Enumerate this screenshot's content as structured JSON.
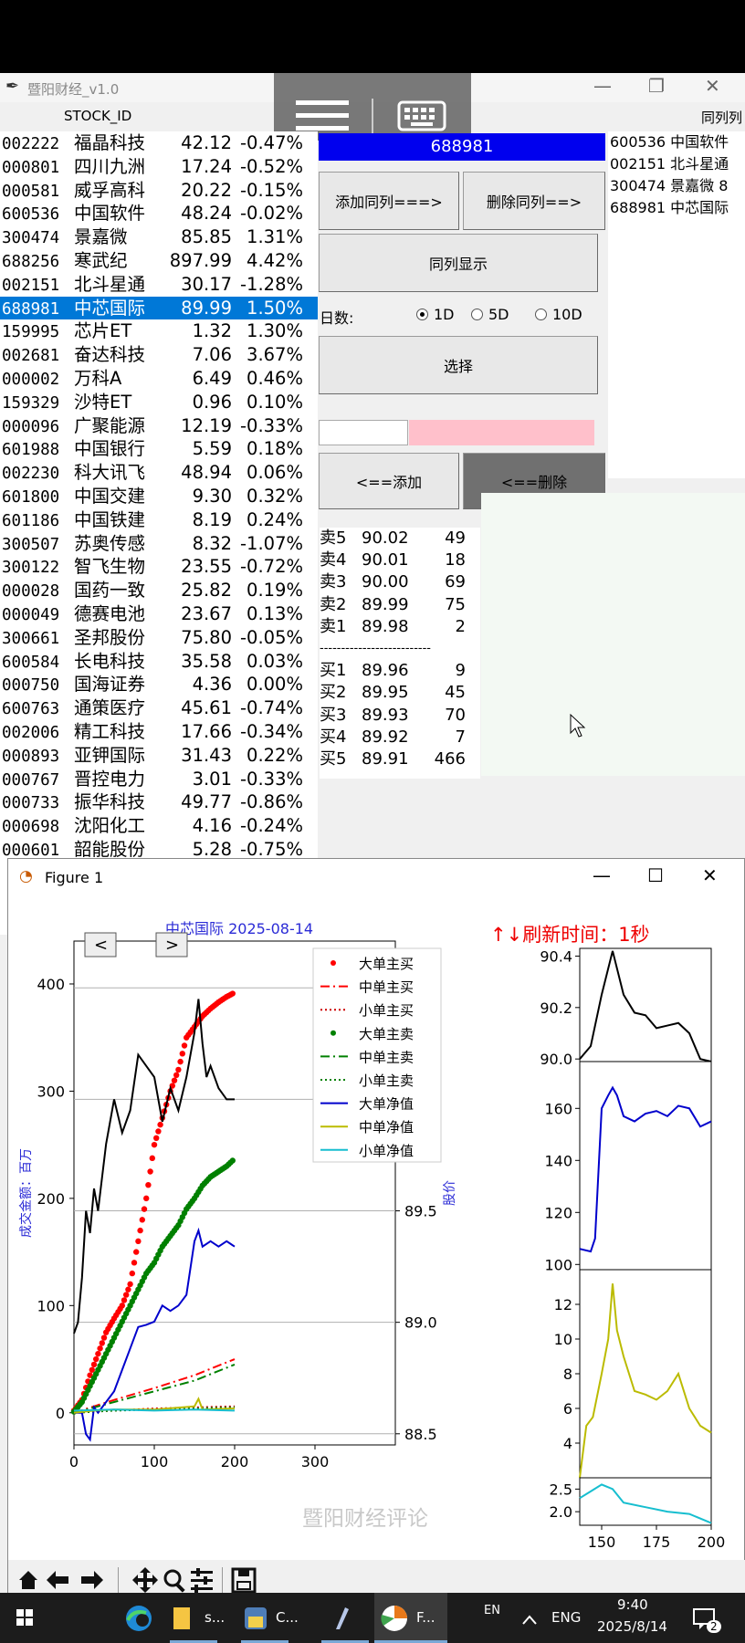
{
  "main_window": {
    "title": "暨阳财经_v1.0",
    "stock_id_header": "STOCK_ID",
    "peer_header": "同列列"
  },
  "stocks": [
    {
      "code": "002222",
      "name": "福晶科技",
      "price": "42.12",
      "pct": "-0.47%"
    },
    {
      "code": "000801",
      "name": "四川九洲",
      "price": "17.24",
      "pct": "-0.52%"
    },
    {
      "code": "000581",
      "name": "威孚高科",
      "price": "20.22",
      "pct": "-0.15%"
    },
    {
      "code": "600536",
      "name": "中国软件",
      "price": "48.24",
      "pct": "-0.02%"
    },
    {
      "code": "300474",
      "name": "景嘉微",
      "price": "85.85",
      "pct": "1.31%"
    },
    {
      "code": "688256",
      "name": "寒武纪",
      "price": "897.99",
      "pct": "4.42%"
    },
    {
      "code": "002151",
      "name": "北斗星通",
      "price": "30.17",
      "pct": "-1.28%"
    },
    {
      "code": "688981",
      "name": "中芯国际",
      "price": "89.99",
      "pct": "1.50%"
    },
    {
      "code": "159995",
      "name": "芯片ET",
      "price": "1.32",
      "pct": "1.30%"
    },
    {
      "code": "002681",
      "name": "奋达科技",
      "price": "7.06",
      "pct": "3.67%"
    },
    {
      "code": "000002",
      "name": "万科A",
      "price": "6.49",
      "pct": "0.46%"
    },
    {
      "code": "159329",
      "name": "沙特ET",
      "price": "0.96",
      "pct": "0.10%"
    },
    {
      "code": "000096",
      "name": "广聚能源",
      "price": "12.19",
      "pct": "-0.33%"
    },
    {
      "code": "601988",
      "name": "中国银行",
      "price": "5.59",
      "pct": "0.18%"
    },
    {
      "code": "002230",
      "name": "科大讯飞",
      "price": "48.94",
      "pct": "0.06%"
    },
    {
      "code": "601800",
      "name": "中国交建",
      "price": "9.30",
      "pct": "0.32%"
    },
    {
      "code": "601186",
      "name": "中国铁建",
      "price": "8.19",
      "pct": "0.24%"
    },
    {
      "code": "300507",
      "name": "苏奥传感",
      "price": "8.32",
      "pct": "-1.07%"
    },
    {
      "code": "300122",
      "name": "智飞生物",
      "price": "23.55",
      "pct": "-0.72%"
    },
    {
      "code": "000028",
      "name": "国药一致",
      "price": "25.82",
      "pct": "0.19%"
    },
    {
      "code": "000049",
      "name": "德赛电池",
      "price": "23.67",
      "pct": "0.13%"
    },
    {
      "code": "300661",
      "name": "圣邦股份",
      "price": "75.80",
      "pct": "-0.05%"
    },
    {
      "code": "600584",
      "name": "长电科技",
      "price": "35.58",
      "pct": "0.03%"
    },
    {
      "code": "000750",
      "name": "国海证券",
      "price": "4.36",
      "pct": "0.00%"
    },
    {
      "code": "600763",
      "name": "通策医疗",
      "price": "45.61",
      "pct": "-0.74%"
    },
    {
      "code": "002006",
      "name": "精工科技",
      "price": "17.66",
      "pct": "-0.34%"
    },
    {
      "code": "000893",
      "name": "亚钾国际",
      "price": "31.43",
      "pct": "0.22%"
    },
    {
      "code": "000767",
      "name": "晋控电力",
      "price": "3.01",
      "pct": "-0.33%"
    },
    {
      "code": "000733",
      "name": "振华科技",
      "price": "49.77",
      "pct": "-0.86%"
    },
    {
      "code": "000698",
      "name": "沈阳化工",
      "price": "4.16",
      "pct": "-0.24%"
    },
    {
      "code": "000601",
      "name": "韶能股份",
      "price": "5.28",
      "pct": "-0.75%"
    }
  ],
  "selected_index": 7,
  "peers": [
    "600536 中国软件",
    "002151 北斗星通",
    "300474 景嘉微  8",
    "688981 中芯国际"
  ],
  "controls": {
    "code_display": "688981",
    "add_peer": "添加同列===>",
    "del_peer": "删除同列==>",
    "show_peer": "同列显示",
    "days_label": "日数:",
    "opt_1d": "1D",
    "opt_5d": "5D",
    "opt_10d": "10D",
    "selected_days": "1D",
    "select": "选择",
    "add": "<==添加",
    "del": "<==删除"
  },
  "orderbook": {
    "asks": [
      {
        "label": "卖5",
        "price": "90.02",
        "vol": "49"
      },
      {
        "label": "卖4",
        "price": "90.01",
        "vol": "18"
      },
      {
        "label": "卖3",
        "price": "90.00",
        "vol": "69"
      },
      {
        "label": "卖2",
        "price": "89.99",
        "vol": "75"
      },
      {
        "label": "卖1",
        "price": "89.98",
        "vol": "2"
      }
    ],
    "divider": "--------------------------",
    "bids": [
      {
        "label": "买1",
        "price": "89.96",
        "vol": "9"
      },
      {
        "label": "买2",
        "price": "89.95",
        "vol": "45"
      },
      {
        "label": "买3",
        "price": "89.93",
        "vol": "70"
      },
      {
        "label": "买4",
        "price": "89.92",
        "vol": "7"
      },
      {
        "label": "买5",
        "price": "89.91",
        "vol": "466"
      }
    ]
  },
  "figure": {
    "window_title": "Figure 1",
    "chart_title": "中芯国际  2025-08-14",
    "refresh_label": "↑↓刷新时间：1秒",
    "watermark": "暨阳财经评论"
  },
  "chart_data": [
    {
      "type": "line",
      "title": "中芯国际  2025-08-14",
      "ylabel": "成交金额：百万",
      "ylabel_right": "股价",
      "xlim": [
        0,
        400
      ],
      "xticks": [
        0,
        100,
        200,
        300
      ],
      "ylim": [
        -30,
        440
      ],
      "yticks": [
        0,
        100,
        200,
        300,
        400
      ],
      "y2lim": [
        88.45,
        90.71
      ],
      "y2ticks": [
        88.5,
        89.0,
        89.5,
        90.0,
        90.5
      ],
      "legend": "top-right",
      "series": [
        {
          "name": "大单主买",
          "style": "dot",
          "color": "#ff0000",
          "x": [
            0,
            10,
            20,
            30,
            40,
            50,
            60,
            70,
            80,
            90,
            100,
            110,
            120,
            130,
            140,
            150,
            160,
            170,
            180,
            190,
            200
          ],
          "y": [
            2,
            12,
            35,
            55,
            75,
            88,
            100,
            120,
            160,
            200,
            250,
            275,
            300,
            320,
            350,
            360,
            370,
            377,
            383,
            388,
            392
          ]
        },
        {
          "name": "中单主买",
          "style": "dashdot",
          "color": "#ff0000",
          "x": [
            0,
            50,
            100,
            150,
            200
          ],
          "y": [
            0,
            12,
            23,
            35,
            50
          ]
        },
        {
          "name": "小单主买",
          "style": "dotted",
          "color": "#cc0000",
          "x": [
            0,
            50,
            100,
            150,
            200
          ],
          "y": [
            0,
            2,
            4,
            5,
            6
          ]
        },
        {
          "name": "大单主卖",
          "style": "dot",
          "color": "#008000",
          "x": [
            0,
            10,
            20,
            30,
            40,
            50,
            60,
            70,
            80,
            90,
            100,
            110,
            120,
            130,
            140,
            150,
            160,
            170,
            180,
            190,
            200
          ],
          "y": [
            1,
            10,
            25,
            40,
            55,
            70,
            85,
            100,
            115,
            130,
            140,
            155,
            165,
            175,
            190,
            200,
            212,
            220,
            225,
            230,
            237
          ]
        },
        {
          "name": "中单主卖",
          "style": "dashdot",
          "color": "#008000",
          "x": [
            0,
            50,
            100,
            150,
            200
          ],
          "y": [
            0,
            10,
            20,
            30,
            45
          ]
        },
        {
          "name": "小单主卖",
          "style": "dotted",
          "color": "#008000",
          "x": [
            0,
            50,
            100,
            150,
            200
          ],
          "y": [
            0,
            2,
            3,
            4,
            5
          ]
        },
        {
          "name": "大单净值",
          "style": "line",
          "color": "#0000cc",
          "x": [
            0,
            10,
            15,
            20,
            25,
            30,
            40,
            50,
            60,
            70,
            80,
            90,
            100,
            110,
            120,
            130,
            140,
            150,
            155,
            160,
            170,
            180,
            190,
            200
          ],
          "y": [
            0,
            0,
            -20,
            -25,
            5,
            0,
            10,
            20,
            40,
            60,
            80,
            82,
            85,
            100,
            95,
            100,
            110,
            160,
            170,
            155,
            160,
            155,
            160,
            155
          ]
        },
        {
          "name": "中单净值",
          "style": "line",
          "color": "#bbbb00",
          "x": [
            0,
            25,
            50,
            100,
            150,
            155,
            160,
            200
          ],
          "y": [
            0,
            2,
            3,
            3,
            6,
            13,
            3,
            4
          ]
        },
        {
          "name": "小单净值",
          "style": "line",
          "color": "#17becf",
          "x": [
            0,
            50,
            100,
            150,
            200
          ],
          "y": [
            2,
            3,
            2,
            3,
            2
          ]
        },
        {
          "name": "",
          "axis": "right",
          "style": "line",
          "color": "#000000",
          "x": [
            0,
            5,
            10,
            15,
            20,
            25,
            30,
            40,
            50,
            60,
            70,
            80,
            90,
            100,
            110,
            120,
            130,
            140,
            150,
            155,
            160,
            165,
            170,
            180,
            190,
            200
          ],
          "y": [
            88.95,
            89.0,
            89.2,
            89.5,
            89.4,
            89.6,
            89.5,
            89.8,
            90.0,
            89.85,
            89.95,
            90.2,
            90.15,
            90.1,
            89.9,
            90.05,
            89.95,
            90.1,
            90.3,
            90.45,
            90.25,
            90.1,
            90.15,
            90.05,
            90.0,
            90.0
          ]
        }
      ]
    },
    {
      "type": "line",
      "xlim": [
        140,
        200
      ],
      "xticks": [
        150,
        175,
        200
      ],
      "ylim": [
        89.99,
        90.43
      ],
      "yticks": [
        90.0,
        90.2,
        90.4
      ],
      "series": [
        {
          "color": "#000000",
          "x": [
            140,
            145,
            150,
            155,
            160,
            165,
            170,
            175,
            180,
            185,
            190,
            195,
            200
          ],
          "y": [
            90.0,
            90.05,
            90.25,
            90.42,
            90.25,
            90.18,
            90.17,
            90.12,
            90.13,
            90.14,
            90.1,
            90.0,
            89.99
          ]
        }
      ]
    },
    {
      "type": "line",
      "xlim": [
        140,
        200
      ],
      "ylim": [
        98,
        178
      ],
      "yticks": [
        100,
        120,
        140,
        160
      ],
      "series": [
        {
          "color": "#0000cc",
          "x": [
            140,
            145,
            147,
            150,
            153,
            155,
            157,
            160,
            165,
            170,
            175,
            180,
            185,
            190,
            195,
            200
          ],
          "y": [
            106,
            105,
            110,
            160,
            165,
            168,
            165,
            157,
            155,
            158,
            159,
            157,
            161,
            160,
            153,
            155
          ]
        }
      ]
    },
    {
      "type": "line",
      "xlim": [
        140,
        200
      ],
      "ylim": [
        2,
        14
      ],
      "yticks": [
        4,
        6,
        8,
        10,
        12
      ],
      "series": [
        {
          "color": "#bbbb00",
          "x": [
            140,
            143,
            146,
            150,
            153,
            155,
            157,
            160,
            165,
            170,
            175,
            180,
            185,
            190,
            195,
            200
          ],
          "y": [
            2,
            5,
            5.5,
            8,
            10,
            13.2,
            10.5,
            9,
            7,
            6.8,
            6.5,
            7,
            8,
            6,
            5,
            4.6
          ]
        }
      ]
    },
    {
      "type": "line",
      "xlim": [
        140,
        200
      ],
      "ylim": [
        1.7,
        2.75
      ],
      "yticks": [
        2.0,
        2.5
      ],
      "series": [
        {
          "color": "#17becf",
          "x": [
            140,
            145,
            150,
            155,
            160,
            170,
            180,
            190,
            200
          ],
          "y": [
            2.3,
            2.45,
            2.6,
            2.5,
            2.2,
            2.1,
            2.0,
            1.95,
            1.75
          ]
        }
      ]
    }
  ],
  "taskbar": {
    "btn1": "s...",
    "btn2": "C...",
    "btn3": "F...",
    "lang1": "EN",
    "lang2": "ENG",
    "time": "9:40",
    "date": "2025/8/14",
    "badge": "2"
  }
}
